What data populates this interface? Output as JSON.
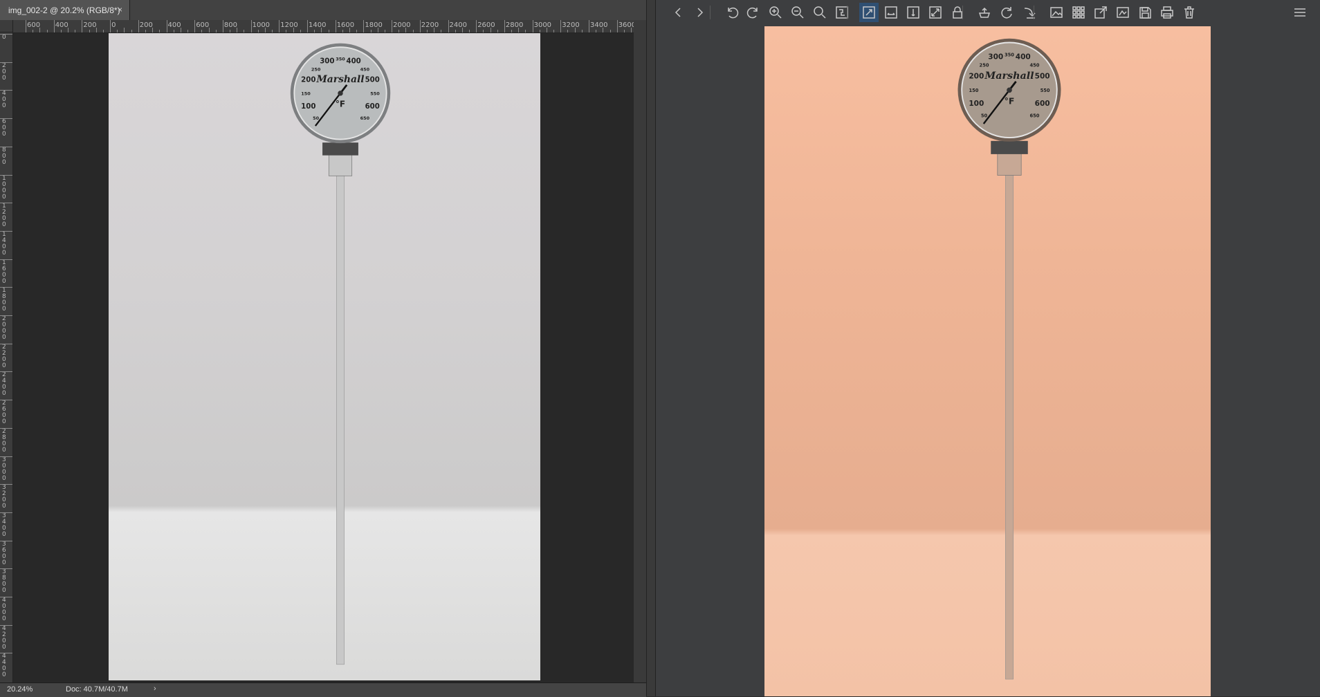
{
  "left_editor": {
    "tab_title": "img_002-2 @ 20.2% (RGB/8*)",
    "tab_close": "×",
    "h_ruler_labels": [
      "600",
      "400",
      "200",
      "0",
      "200",
      "400",
      "600",
      "800",
      "1000",
      "1200",
      "1400",
      "1600",
      "1800",
      "2000",
      "2200",
      "2400",
      "2600",
      "2800",
      "3000",
      "3200",
      "3400",
      "3600"
    ],
    "v_ruler_labels": [
      "0",
      "200",
      "400",
      "600",
      "800",
      "1000",
      "1200",
      "1400",
      "1600",
      "1800",
      "2000",
      "2200",
      "2400",
      "2600",
      "2800",
      "3000",
      "3200",
      "3400",
      "3600",
      "3800",
      "4000",
      "4200",
      "4400"
    ],
    "status": {
      "zoom": "20.24%",
      "doc": "Doc: 40.7M/40.7M",
      "arrow": "›"
    }
  },
  "gauge": {
    "brand": "Marshall",
    "unit": "°F",
    "scale": [
      "50",
      "100",
      "150",
      "200",
      "250",
      "300",
      "350",
      "400",
      "450",
      "500",
      "550",
      "600",
      "650"
    ]
  },
  "right_viewer": {
    "toolbar_icons": [
      "previous-icon",
      "next-icon",
      "rotate-left-icon",
      "rotate-right-icon",
      "zoom-in-icon",
      "zoom-out-icon",
      "zoom-fit-icon",
      "actual-size-icon",
      "fit-window-icon",
      "fit-width-icon",
      "fit-height-icon",
      "fullscreen-icon",
      "lock-zoom-icon",
      "crop-icon",
      "refresh-icon",
      "redo-icon",
      "image-info-icon",
      "thumbnails-icon",
      "open-external-icon",
      "slideshow-icon",
      "save-icon",
      "print-icon",
      "delete-icon",
      "menu-icon"
    ]
  },
  "colors": {
    "editor_bg": "#282828",
    "viewer_bg": "#3d3e40",
    "active_tool": "#2f4f72",
    "left_photo_tone": "#d4d2d3",
    "right_photo_tone": "#efb596"
  }
}
